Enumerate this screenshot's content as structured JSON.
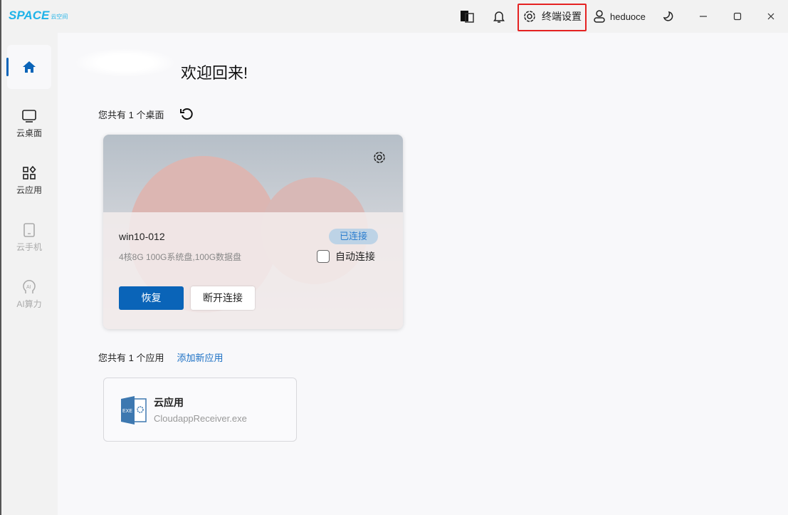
{
  "app": {
    "logo_text": "SPACE",
    "logo_sub": "云空间"
  },
  "titlebar": {
    "settings_label": "终端设置",
    "username": "heduoce"
  },
  "sidebar": {
    "items": [
      {
        "label": "首页"
      },
      {
        "label": "云桌面"
      },
      {
        "label": "云应用"
      },
      {
        "label": "云手机"
      },
      {
        "label": "AI算力"
      }
    ]
  },
  "main": {
    "welcome": "欢迎回来!",
    "desktops_count_label": "您共有 1 个桌面",
    "desktop": {
      "name": "win10-012",
      "spec": "4核8G 100G系统盘,100G数据盘",
      "status": "已连接",
      "auto_connect_label": "自动连接",
      "auto_connect": false,
      "restore_label": "恢复",
      "disconnect_label": "断开连接"
    },
    "apps_count_label": "您共有 1 个应用",
    "add_app_label": "添加新应用",
    "app": {
      "name": "云应用",
      "file": "CloudappReceiver.exe",
      "icon_text": "EXE"
    }
  },
  "colors": {
    "accent": "#0a64b8",
    "highlight": "#e52222"
  }
}
